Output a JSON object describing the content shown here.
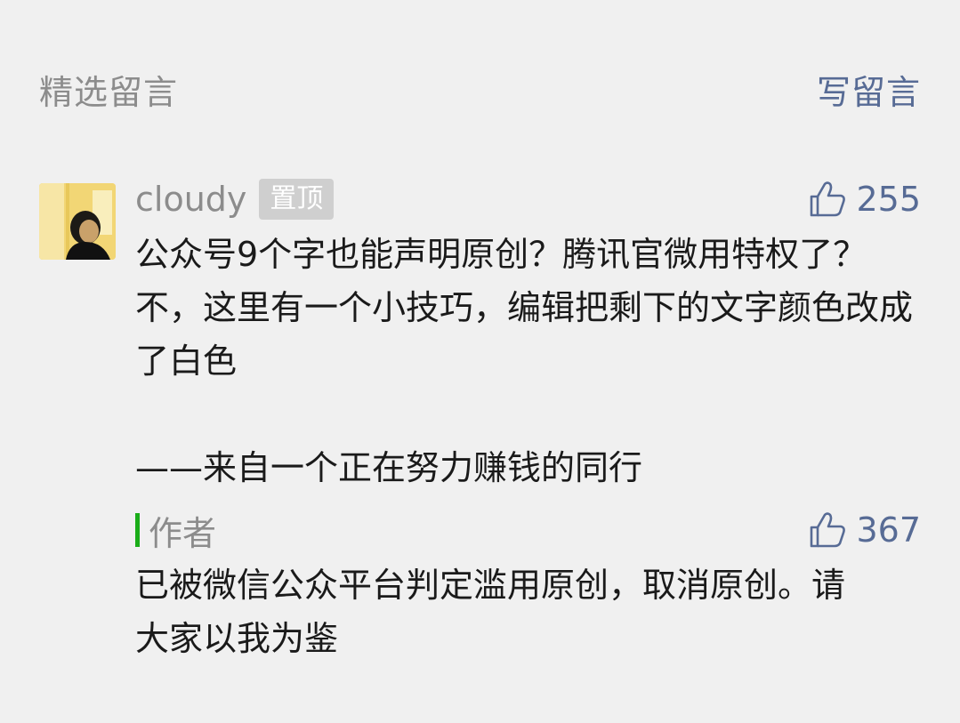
{
  "header": {
    "section_title": "精选留言",
    "write_comment_label": "写留言"
  },
  "comment": {
    "nickname": "cloudy",
    "pin_badge": "置顶",
    "like_count": "255",
    "content": "公众号9个字也能声明原创？腾讯官微用特权了？不，这里有一个小技巧，编辑把剩下的文字颜色改成了白色\n\n——来自一个正在努力赚钱的同行"
  },
  "reply": {
    "author_label": "作者",
    "like_count": "367",
    "content": "已被微信公众平台判定滥用原创，取消原创。请大家以我为鉴"
  },
  "icons": {
    "like": "thumbs-up-icon",
    "author_marker": "green-bar"
  },
  "colors": {
    "background": "#f0f0f0",
    "link_blue": "#576b95",
    "muted_gray": "#8c8c8c",
    "text_dark": "#1a1a1a",
    "author_green": "#1aad19",
    "badge_gray": "#cfcfcf"
  }
}
